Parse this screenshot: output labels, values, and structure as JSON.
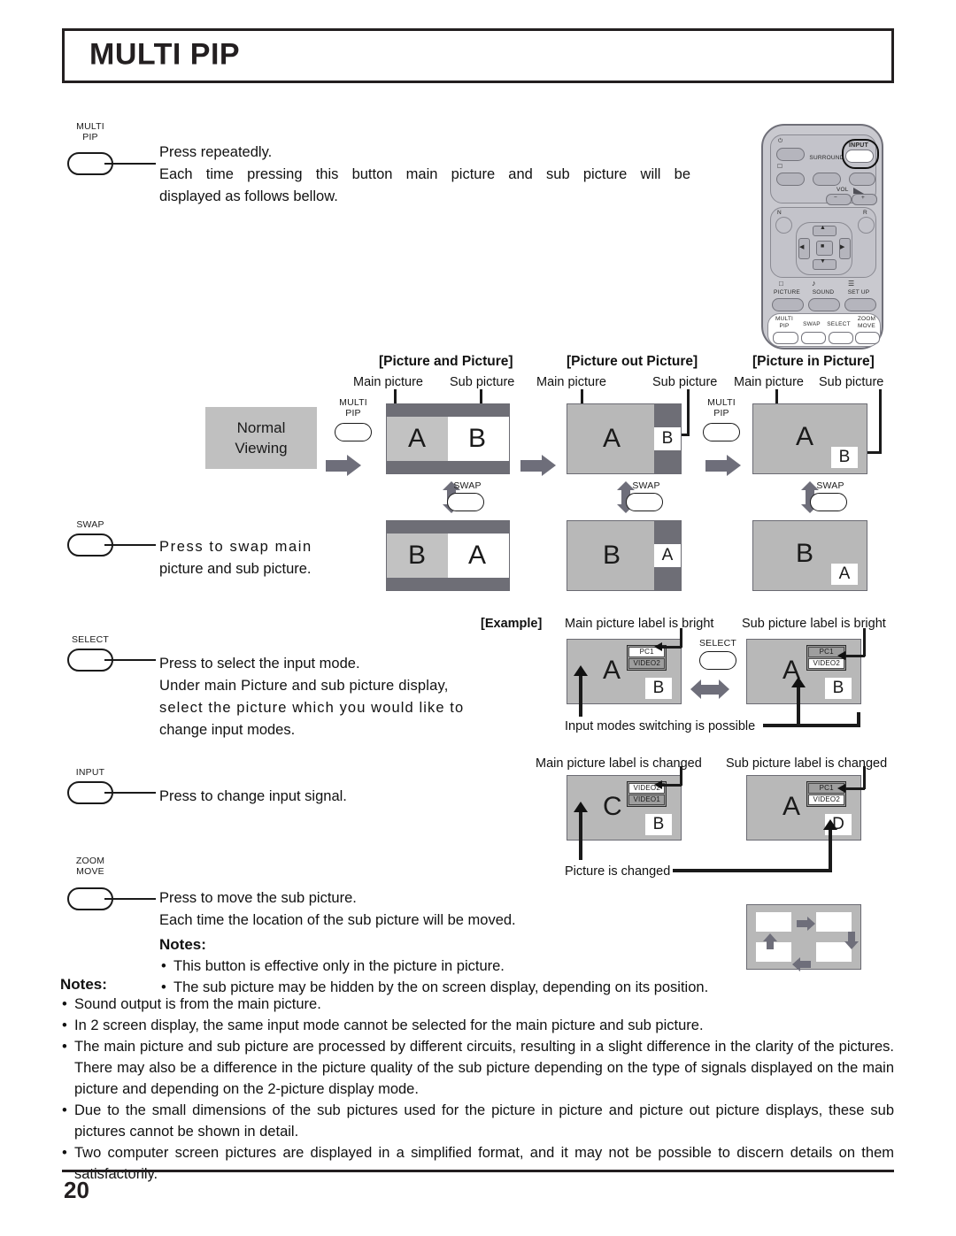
{
  "page": {
    "title": "MULTI PIP",
    "number": "20"
  },
  "remote": {
    "name": "remote-control",
    "keys": {
      "power": "power-icon",
      "input": "INPUT",
      "surround": "SURROUND",
      "vol": "VOL",
      "vol_minus": "−",
      "vol_plus": "+",
      "n": "N",
      "r": "R",
      "up": "▲",
      "down": "▼",
      "left": "◀",
      "right": "▶",
      "enter": "■",
      "picture": "PICTURE",
      "sound": "SOUND",
      "setup": "SET UP",
      "multi_pip_line1": "MULTI",
      "multi_pip_line2": "PIP",
      "swap": "SWAP",
      "select": "SELECT",
      "zoom_line1": "ZOOM",
      "zoom_line2": "MOVE"
    }
  },
  "sections": {
    "multi_pip": {
      "button_line1": "MULTI",
      "button_line2": "PIP",
      "line1": "Press repeatedly.",
      "line2": "Each time pressing this button main picture and sub picture will be",
      "line3": "displayed as follows bellow."
    },
    "swap": {
      "button_label": "SWAP",
      "line1": "Press to swap main",
      "line2": "picture and sub picture."
    },
    "select": {
      "button_label": "SELECT",
      "line1": "Press to select the input mode.",
      "line2": "Under main Picture and sub picture display,",
      "line3": "select the picture which you would like to",
      "line4": "change input modes."
    },
    "input": {
      "button_label": "INPUT",
      "line1": "Press to change input signal."
    },
    "zoom_move": {
      "button_line1": "ZOOM",
      "button_line2": "MOVE",
      "line1": "Press to move the sub picture.",
      "line2": "Each time the location of the sub picture will be moved.",
      "notes_heading": "Notes:",
      "notes": [
        "This button is effective only in the picture in picture.",
        "The sub picture may be hidden by the on screen display, depending on its position."
      ]
    }
  },
  "diagram": {
    "normal_viewing_line1": "Normal",
    "normal_viewing_line2": "Viewing",
    "multi_pip_caption_line1": "MULTI",
    "multi_pip_caption_line2": "PIP",
    "swap_caption": "SWAP",
    "columns": [
      {
        "heading": "[Picture and Picture]",
        "main_label": "Main picture",
        "sub_label": "Sub picture",
        "top_main": "A",
        "top_sub": "B",
        "bottom_main": "B",
        "bottom_sub": "A"
      },
      {
        "heading": "[Picture out Picture]",
        "main_label": "Main picture",
        "sub_label": "Sub picture",
        "top_main": "A",
        "top_sub": "B",
        "bottom_main": "B",
        "bottom_sub": "A"
      },
      {
        "heading": "[Picture in Picture]",
        "main_label": "Main picture",
        "sub_label": "Sub picture",
        "top_main": "A",
        "top_sub": "B",
        "bottom_main": "B",
        "bottom_sub": "A"
      }
    ]
  },
  "example": {
    "tag": "[Example]",
    "select_caption": "SELECT",
    "row1": {
      "left_caption": "Main picture label is bright",
      "right_caption": "Sub picture label is bright",
      "bottom_caption": "Input modes switching is possible",
      "left_screen": {
        "main": "A",
        "sub": "B",
        "label_top": "PC1",
        "label_bottom": "VIDEO2",
        "bright": "top"
      },
      "right_screen": {
        "main": "A",
        "sub": "B",
        "label_top": "PC1",
        "label_bottom": "VIDEO2",
        "bright": "bottom"
      }
    },
    "row2": {
      "left_caption": "Main picture label is changed",
      "right_caption": "Sub picture label is changed",
      "bottom_caption": "Picture is changed",
      "left_screen": {
        "main": "C",
        "sub": "B",
        "label_top": "VIDEO2",
        "label_bottom": "VIDEO1",
        "bright": "top"
      },
      "right_screen": {
        "main": "A",
        "sub": "D",
        "label_top": "PC1",
        "label_bottom": "VIDEO2",
        "bright": "bottom"
      }
    }
  },
  "bottom_notes": {
    "heading": "Notes:",
    "items": [
      "Sound output is from the main picture.",
      "In 2 screen display, the same input mode cannot be selected for the main picture and sub picture.",
      "The main picture and sub picture are processed by different circuits, resulting in a slight difference in the clarity of the pictures. There may also be a difference in the picture quality of the sub picture depending on the type of signals displayed on the main picture and depending on the 2-picture display mode.",
      "Due to the small dimensions of the sub pictures used for the picture in picture and picture out picture displays, these sub pictures cannot be shown in detail.",
      "Two computer screen pictures are displayed in a simplified format, and it may not be possible to discern details on them satisfactorily."
    ]
  },
  "colors": {
    "ink": "#231f20",
    "screen_gray": "#b8b8b8",
    "bar_gray": "#6e6e76",
    "light_gray": "#c2c2c2",
    "arrow_gray": "#6e6e7a"
  }
}
